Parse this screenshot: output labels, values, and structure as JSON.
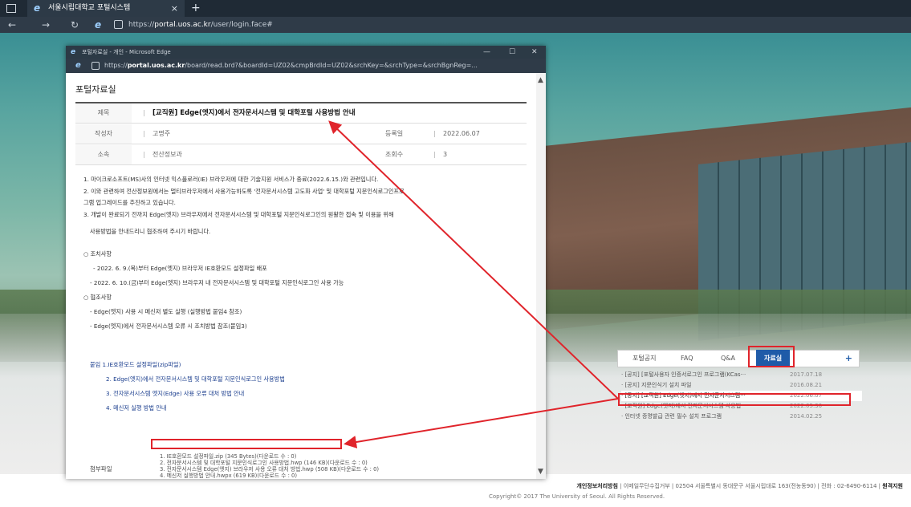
{
  "browser": {
    "tab_title": "서울시립대학교 포털시스템",
    "tab_close": "×",
    "new_tab": "+",
    "url_prefix": "https://",
    "url_host": "portal.uos.ac.kr",
    "url_path": "/user/login.face#"
  },
  "popup": {
    "window_title": "포털자료실 - 개인 - Microsoft Edge",
    "url_prefix": "https://",
    "url_host": "portal.uos.ac.kr",
    "url_path": "/board/read.brd?&boardId=UZ02&cmpBrdId=UZ02&srchKey=&srchType=&srchBgnReg=...",
    "page_heading": "포털자료실",
    "meta": {
      "title_label": "제목",
      "title_value": "[교직원] Edge(엣지)에서 전자문서시스템 및 대학포털 사용방법 안내",
      "author_label": "작성자",
      "author_value": "고명주",
      "date_label": "등록일",
      "date_value": "2022.06.07",
      "dept_label": "소속",
      "dept_value": "전산정보과",
      "views_label": "조회수",
      "views_value": "3"
    },
    "body_lines": [
      "1. 마이크로소프트(MS)사의 인터넷 익스플로러(IE) 브라우저에 대한 기술지원 서비스가 종료(2022.6.15.)와 관련입니다.",
      "2. 이와 관련하여 전산정보원에서는 멀티브라우저에서 사용가능하도록 '전자문서시스템 고도화 사업' 및 대학포털 지문인식로그인프로",
      "그램 업그레이드를 추진하고 있습니다.",
      "3. 개발이 완료되기 전까지 Edge(엣지) 브라우저에서 전자문서시스템 및 대학포털 지문인식로그인의 원활한 접속 및 이용을 위해",
      "사용방법을 안내드리니 협조하여 주시기 바랍니다.",
      "○ 조치사항",
      "- 2022. 6. 9.(목)부터 Edge(엣지) 브라우저 IE호환모드 설정파일 배포",
      "- 2022. 6. 10.(금)부터 Edge(엣지) 브라우저 내 전자문서시스템 및 대학포털 지문인식로그인 사용 가능",
      "○ 협조사항",
      "- Edge(엣지) 사용 시 메신저 별도 실행 (실행방법 붙임4 참조)",
      "- Edge(엣지)에서 전자문서시스템 오류 시 조치방법 참조(붙임3)"
    ],
    "attachments_heading": "붙임 1.IE호환모드 설정파일(zip파일)",
    "attachments_items": [
      "2. Edge(엣지)에서 전자문서시스템 및 대학포털 지문인식로그인 사용방법",
      "3. 전자문서시스템 엣지(Edge) 사용 오류 대처 방법 안내",
      "4. 메신저 실행 방법 안내"
    ],
    "files_label": "첨부파일",
    "files": [
      "1. IE호환모드 설정파일.zip (345 Bytes)(다운로드 수 : 0)",
      "2. 전자문서시스템 및 대학포털 지문인식로그인 사용방법.hwp (146 KB)(다운로드 수 : 0)",
      "3. 전자문서시스템 Edge(엣지) 브라우저 사용 오류 대처 방법.hwp (508 KB)(다운로드 수 : 0)",
      "4. 메신저 실행방법 안내.hwpx (619 KB)(다운로드 수 : 0)"
    ]
  },
  "board": {
    "tabs": [
      "포털공지",
      "FAQ",
      "Q&A",
      "자료실"
    ],
    "active_tab": "자료실",
    "plus": "+",
    "items": [
      {
        "title": "· [공지] [포털사용자 인증서로그인 프로그램(KCas···",
        "date": "2017.07.18"
      },
      {
        "title": "· [공지] 지문인식기 설치 파일",
        "date": "2016.08.21"
      },
      {
        "title": "· [공지] [교직원] Edge(엣지)에서 전자문서시스템···",
        "date": "2022.06.07"
      },
      {
        "title": "· [교직원] Edge(엣지)에서 전자문서시스템 사용법",
        "date": "2022.05.30"
      },
      {
        "title": "· 인터넷 증명발급 관련 필수 설치 프로그램",
        "date": "2014.02.25"
      }
    ]
  },
  "footer": {
    "privacy": "개인정보처리방침",
    "line": "|  이메일무단수집거부  |  02504 서울특별시 동대문구 서울시립대로 163(전농동90)  |  전화 : 02-6490-6114  |",
    "remote": "원격지원",
    "copyright": "Copyright© 2017 The University of Seoul. All Rights Reserved."
  },
  "colors": {
    "highlight": "#e0242b",
    "active_tab": "#1f5ba8",
    "chrome_dark": "#1f2a35"
  }
}
